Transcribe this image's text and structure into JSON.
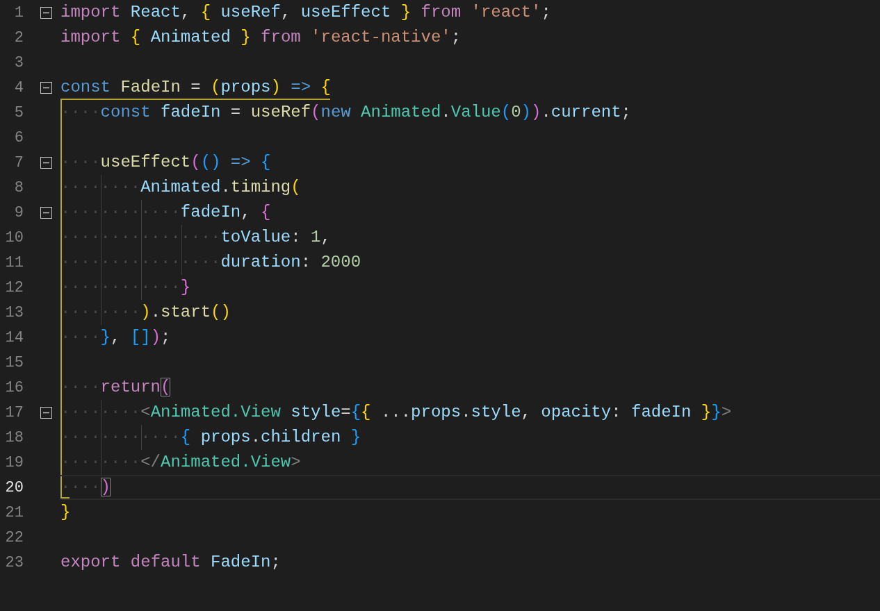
{
  "editor": {
    "lines": [
      {
        "number": "1",
        "foldable": true,
        "current": false,
        "tokens": [
          {
            "text": "import ",
            "kind": "kw"
          },
          {
            "text": "React",
            "kind": "var"
          },
          {
            "text": ", ",
            "kind": "p"
          },
          {
            "text": "{ ",
            "kind": "b1"
          },
          {
            "text": "useRef",
            "kind": "var"
          },
          {
            "text": ", ",
            "kind": "p"
          },
          {
            "text": "useEffect ",
            "kind": "var"
          },
          {
            "text": "} ",
            "kind": "b1"
          },
          {
            "text": "from ",
            "kind": "kw"
          },
          {
            "text": "'react'",
            "kind": "str"
          },
          {
            "text": ";",
            "kind": "p"
          }
        ]
      },
      {
        "number": "2",
        "foldable": false,
        "current": false,
        "tokens": [
          {
            "text": "import ",
            "kind": "kw"
          },
          {
            "text": "{ ",
            "kind": "b1"
          },
          {
            "text": "Animated ",
            "kind": "var"
          },
          {
            "text": "} ",
            "kind": "b1"
          },
          {
            "text": "from ",
            "kind": "kw"
          },
          {
            "text": "'react-native'",
            "kind": "str"
          },
          {
            "text": ";",
            "kind": "p"
          }
        ]
      },
      {
        "number": "3",
        "foldable": false,
        "current": false
      },
      {
        "number": "4",
        "foldable": true,
        "current": false,
        "tokens": [
          {
            "text": "const ",
            "kind": "st"
          },
          {
            "text": "FadeIn",
            "kind": "fn"
          },
          {
            "text": " = ",
            "kind": "p"
          },
          {
            "text": "(",
            "kind": "b1"
          },
          {
            "text": "props",
            "kind": "var"
          },
          {
            "text": ") ",
            "kind": "b1"
          },
          {
            "text": "=> ",
            "kind": "st"
          },
          {
            "text": "{",
            "kind": "b1"
          }
        ]
      },
      {
        "number": "5",
        "foldable": false,
        "current": false,
        "tokens": [
          {
            "text": "····",
            "kind": "ws"
          },
          {
            "text": "const ",
            "kind": "st"
          },
          {
            "text": "fadeIn",
            "kind": "var"
          },
          {
            "text": " = ",
            "kind": "p"
          },
          {
            "text": "useRef",
            "kind": "fn"
          },
          {
            "text": "(",
            "kind": "b2"
          },
          {
            "text": "new ",
            "kind": "st"
          },
          {
            "text": "Animated",
            "kind": "type"
          },
          {
            "text": ".",
            "kind": "p"
          },
          {
            "text": "Value",
            "kind": "type"
          },
          {
            "text": "(",
            "kind": "b3"
          },
          {
            "text": "0",
            "kind": "num"
          },
          {
            "text": ")",
            "kind": "b3"
          },
          {
            "text": ")",
            "kind": "b2"
          },
          {
            "text": ".",
            "kind": "p"
          },
          {
            "text": "current",
            "kind": "var"
          },
          {
            "text": ";",
            "kind": "p"
          }
        ]
      },
      {
        "number": "6",
        "foldable": false,
        "current": false
      },
      {
        "number": "7",
        "foldable": true,
        "current": false,
        "tokens": [
          {
            "text": "····",
            "kind": "ws"
          },
          {
            "text": "useEffect",
            "kind": "fn"
          },
          {
            "text": "(",
            "kind": "b2"
          },
          {
            "text": "() ",
            "kind": "b3"
          },
          {
            "text": "=> ",
            "kind": "st"
          },
          {
            "text": "{",
            "kind": "b3"
          }
        ]
      },
      {
        "number": "8",
        "foldable": false,
        "current": false,
        "tokens": [
          {
            "text": "········",
            "kind": "ws"
          },
          {
            "text": "Animated",
            "kind": "var"
          },
          {
            "text": ".",
            "kind": "p"
          },
          {
            "text": "timing",
            "kind": "fn"
          },
          {
            "text": "(",
            "kind": "b1"
          }
        ]
      },
      {
        "number": "9",
        "foldable": true,
        "current": false,
        "tokens": [
          {
            "text": "············",
            "kind": "ws"
          },
          {
            "text": "fadeIn",
            "kind": "var"
          },
          {
            "text": ", ",
            "kind": "p"
          },
          {
            "text": "{",
            "kind": "b2"
          }
        ]
      },
      {
        "number": "10",
        "foldable": false,
        "current": false,
        "tokens": [
          {
            "text": "················",
            "kind": "ws"
          },
          {
            "text": "toValue",
            "kind": "var"
          },
          {
            "text": ": ",
            "kind": "p"
          },
          {
            "text": "1",
            "kind": "num"
          },
          {
            "text": ",",
            "kind": "p"
          }
        ]
      },
      {
        "number": "11",
        "foldable": false,
        "current": false,
        "tokens": [
          {
            "text": "················",
            "kind": "ws"
          },
          {
            "text": "duration",
            "kind": "var"
          },
          {
            "text": ": ",
            "kind": "p"
          },
          {
            "text": "2000",
            "kind": "num"
          }
        ]
      },
      {
        "number": "12",
        "foldable": false,
        "current": false,
        "tokens": [
          {
            "text": "············",
            "kind": "ws"
          },
          {
            "text": "}",
            "kind": "b2"
          }
        ]
      },
      {
        "number": "13",
        "foldable": false,
        "current": false,
        "tokens": [
          {
            "text": "········",
            "kind": "ws"
          },
          {
            "text": ")",
            "kind": "b1"
          },
          {
            "text": ".",
            "kind": "p"
          },
          {
            "text": "start",
            "kind": "fn"
          },
          {
            "text": "()",
            "kind": "b1"
          }
        ]
      },
      {
        "number": "14",
        "foldable": false,
        "current": false,
        "tokens": [
          {
            "text": "····",
            "kind": "ws"
          },
          {
            "text": "}",
            "kind": "b3"
          },
          {
            "text": ", ",
            "kind": "p"
          },
          {
            "text": "[]",
            "kind": "b3"
          },
          {
            "text": ")",
            "kind": "b2"
          },
          {
            "text": ";",
            "kind": "p"
          }
        ]
      },
      {
        "number": "15",
        "foldable": false,
        "current": false
      },
      {
        "number": "16",
        "foldable": false,
        "current": false,
        "tokens": [
          {
            "text": "····",
            "kind": "ws"
          },
          {
            "text": "return",
            "kind": "kw"
          },
          {
            "text": "(",
            "kind": "b2",
            "match": true
          }
        ]
      },
      {
        "number": "17",
        "foldable": true,
        "current": false,
        "tokens": [
          {
            "text": "········",
            "kind": "ws"
          },
          {
            "text": "<",
            "kind": "tag"
          },
          {
            "text": "Animated.View ",
            "kind": "type"
          },
          {
            "text": "style",
            "kind": "var"
          },
          {
            "text": "=",
            "kind": "p"
          },
          {
            "text": "{",
            "kind": "b3"
          },
          {
            "text": "{",
            "kind": "b1"
          },
          {
            "text": " ...",
            "kind": "p"
          },
          {
            "text": "props",
            "kind": "var"
          },
          {
            "text": ".",
            "kind": "p"
          },
          {
            "text": "style",
            "kind": "var"
          },
          {
            "text": ", ",
            "kind": "p"
          },
          {
            "text": "opacity",
            "kind": "var"
          },
          {
            "text": ": ",
            "kind": "p"
          },
          {
            "text": "fadeIn ",
            "kind": "var"
          },
          {
            "text": "}",
            "kind": "b1"
          },
          {
            "text": "}",
            "kind": "b3"
          },
          {
            "text": ">",
            "kind": "tag"
          }
        ]
      },
      {
        "number": "18",
        "foldable": false,
        "current": false,
        "tokens": [
          {
            "text": "············",
            "kind": "ws"
          },
          {
            "text": "{ ",
            "kind": "b3"
          },
          {
            "text": "props",
            "kind": "var"
          },
          {
            "text": ".",
            "kind": "p"
          },
          {
            "text": "children ",
            "kind": "var"
          },
          {
            "text": "}",
            "kind": "b3"
          }
        ]
      },
      {
        "number": "19",
        "foldable": false,
        "current": false,
        "tokens": [
          {
            "text": "········",
            "kind": "ws"
          },
          {
            "text": "</",
            "kind": "tag"
          },
          {
            "text": "Animated.View",
            "kind": "type"
          },
          {
            "text": ">",
            "kind": "tag"
          }
        ]
      },
      {
        "number": "20",
        "foldable": false,
        "current": true,
        "tokens": [
          {
            "text": "····",
            "kind": "ws"
          },
          {
            "text": ")",
            "kind": "b2",
            "match": true
          }
        ]
      },
      {
        "number": "21",
        "foldable": false,
        "current": false,
        "tokens": [
          {
            "text": "}",
            "kind": "b1"
          }
        ]
      },
      {
        "number": "22",
        "foldable": false,
        "current": false
      },
      {
        "number": "23",
        "foldable": false,
        "current": false,
        "tokens": [
          {
            "text": "export ",
            "kind": "kw"
          },
          {
            "text": "default ",
            "kind": "kw"
          },
          {
            "text": "FadeIn",
            "kind": "var"
          },
          {
            "text": ";",
            "kind": "p"
          }
        ]
      }
    ]
  }
}
